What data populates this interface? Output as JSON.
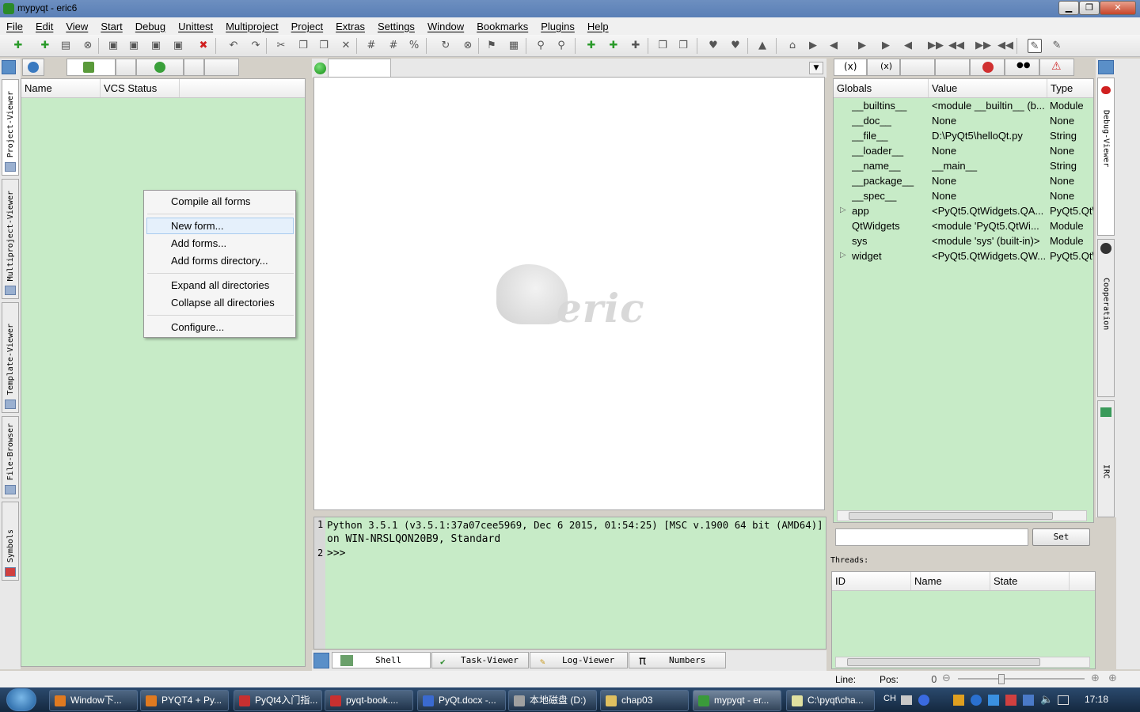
{
  "window": {
    "title": "mypyqt - eric6"
  },
  "menu": [
    "File",
    "Edit",
    "View",
    "Start",
    "Debug",
    "Unittest",
    "Multiproject",
    "Project",
    "Extras",
    "Settings",
    "Window",
    "Bookmarks",
    "Plugins",
    "Help"
  ],
  "left_tabs": [
    "Project-Viewer",
    "Multiproject-Viewer",
    "Template-Viewer",
    "File-Browser",
    "Symbols"
  ],
  "project": {
    "columns": [
      "Name",
      "VCS Status"
    ]
  },
  "context_menu": {
    "items": [
      "Compile all forms",
      "New form...",
      "Add forms...",
      "Add forms directory...",
      "Expand all directories",
      "Collapse all directories",
      "Configure..."
    ]
  },
  "editor": {
    "logo_text": "eric"
  },
  "shell": {
    "line1_no": "1",
    "line2_no": "2",
    "banner_a": "Python ",
    "ver": "3.5.1",
    " banner_b": "",
    "l1": "Python 3.5.1 (v3.5.1:37a07cee5969, Dec  6 2015, 01:54:25) [MSC v.1900 64 bit (AMD64)]",
    "l2": "on WIN-NRSLQON20B9, Standard",
    "prompt": ">>>"
  },
  "bottom_tabs": [
    "Shell",
    "Task-Viewer",
    "Log-Viewer",
    "Numbers"
  ],
  "variables": {
    "columns": [
      "Globals",
      "Value",
      "Type"
    ],
    "rows": [
      {
        "name": "__builtins__",
        "value": "<module __builtin__ (b...",
        "type": "Module",
        "expand": ""
      },
      {
        "name": "__doc__",
        "value": "None",
        "type": "None",
        "expand": ""
      },
      {
        "name": "__file__",
        "value": "D:\\PyQt5\\helloQt.py",
        "type": "String",
        "expand": ""
      },
      {
        "name": "__loader__",
        "value": "None",
        "type": "None",
        "expand": ""
      },
      {
        "name": "__name__",
        "value": "__main__",
        "type": "String",
        "expand": ""
      },
      {
        "name": "__package__",
        "value": "None",
        "type": "None",
        "expand": ""
      },
      {
        "name": "__spec__",
        "value": "None",
        "type": "None",
        "expand": ""
      },
      {
        "name": "app",
        "value": "<PyQt5.QtWidgets.QA...",
        "type": "PyQt5.Qt\\",
        "expand": "▷"
      },
      {
        "name": "QtWidgets",
        "value": "<module 'PyQt5.QtWi...",
        "type": "Module",
        "expand": ""
      },
      {
        "name": "sys",
        "value": "<module 'sys' (built-in)>",
        "type": "Module",
        "expand": ""
      },
      {
        "name": "widget",
        "value": "<PyQt5.QtWidgets.QW...",
        "type": "PyQt5.Qt\\",
        "expand": "▷"
      }
    ]
  },
  "set_button": "Set",
  "threads": {
    "label": "Threads:",
    "columns": [
      "ID",
      "Name",
      "State"
    ]
  },
  "right_tabs": [
    "Debug-Viewer",
    "Cooperation",
    "IRC"
  ],
  "status": {
    "line_label": "Line:",
    "pos_label": "Pos:",
    "zoom": "0"
  },
  "taskbar": {
    "tasks": [
      "Window下...",
      "PYQT4 + Py...",
      "PyQt4入门指...",
      "pyqt-book....",
      "PyQt.docx -...",
      "本地磁盘 (D:)",
      "chap03",
      "mypyqt - er...",
      "C:\\pyqt\\cha..."
    ],
    "lang": "CH",
    "clock": "17:18"
  },
  "colors": {
    "green": "#c7ebc7",
    "accent": "#5a7fb6"
  }
}
